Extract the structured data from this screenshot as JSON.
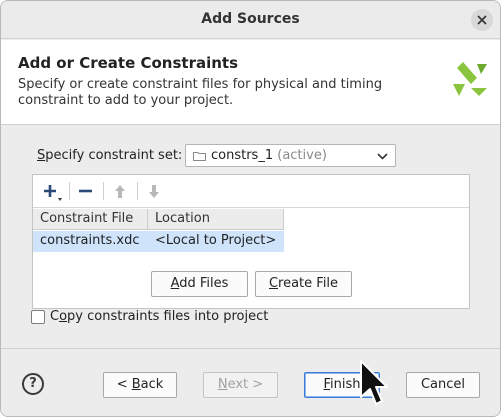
{
  "window": {
    "title": "Add Sources"
  },
  "header": {
    "title": "Add or Create Constraints",
    "description": "Specify or create constraint files for physical and timing constraint to add to your project."
  },
  "constraint_set": {
    "label_accel": "S",
    "label_rest": "pecify constraint set:",
    "value": "constrs_1",
    "status": "(active)"
  },
  "table": {
    "columns": [
      "Constraint File",
      "Location"
    ],
    "rows": [
      {
        "file": "constraints.xdc",
        "location": "<Local to Project>"
      }
    ]
  },
  "buttons": {
    "add_files": {
      "accel": "A",
      "rest": "dd Files"
    },
    "create_file": {
      "accel": "C",
      "rest": "reate File"
    },
    "back": {
      "prefix": "< ",
      "accel": "B",
      "rest": "ack"
    },
    "next": {
      "accel": "N",
      "rest": "ext >"
    },
    "finish": {
      "accel": "F",
      "rest": "inish"
    },
    "cancel": "Cancel"
  },
  "copy_option": {
    "accel": "C",
    "rest_accel": "o",
    "rest": "py constraints files into project",
    "checked": false
  },
  "help": "?",
  "colors": {
    "selection": "#cfe3fb",
    "logo_green": "#8bc53f",
    "focus_border": "#3d7bd6"
  }
}
